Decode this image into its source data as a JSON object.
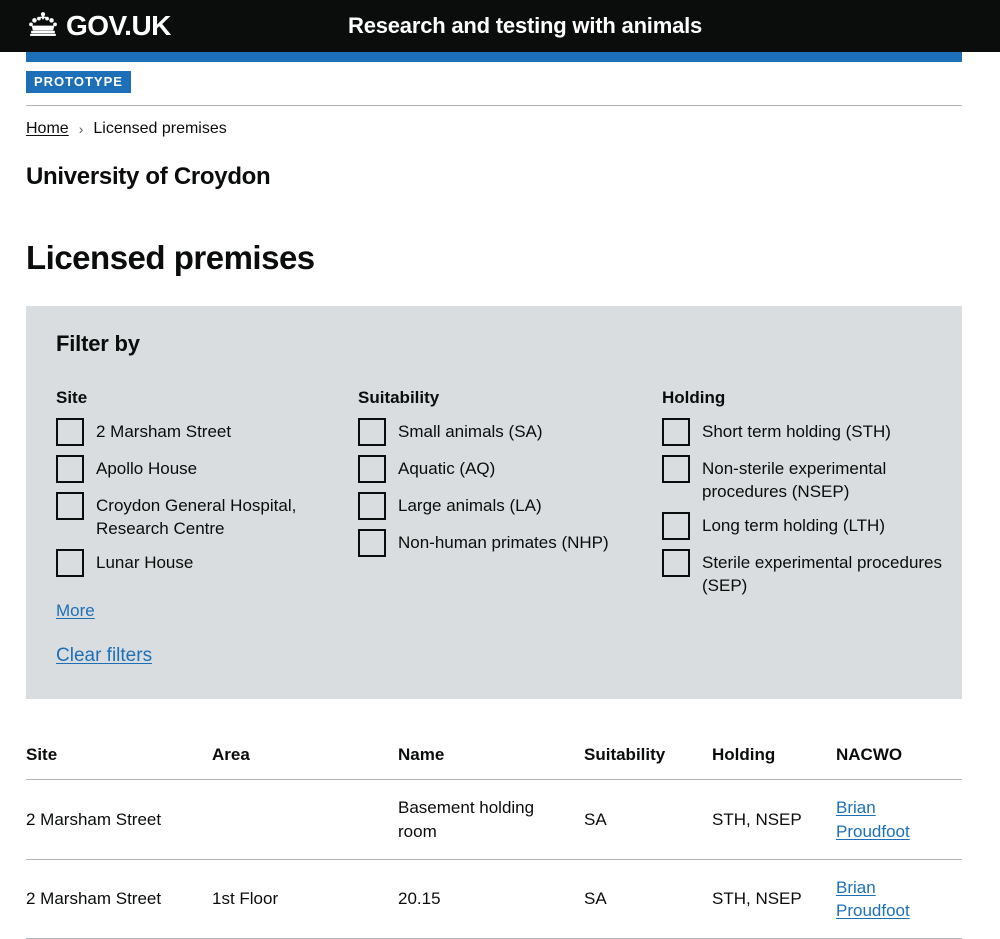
{
  "header": {
    "logo_text": "GOV.UK",
    "crown_icon": "crown-icon",
    "service_name": "Research and testing with animals"
  },
  "phase_banner": {
    "tag": "PROTOTYPE"
  },
  "breadcrumbs": {
    "home": "Home",
    "separator": "›",
    "current": "Licensed premises"
  },
  "page": {
    "caption": "University of Croydon",
    "title": "Licensed premises"
  },
  "filter": {
    "heading": "Filter by",
    "groups": [
      {
        "legend": "Site",
        "options": [
          {
            "label": "2 Marsham Street",
            "checked": false
          },
          {
            "label": "Apollo House",
            "checked": false
          },
          {
            "label": "Croydon General Hospital, Research Centre",
            "checked": false
          },
          {
            "label": "Lunar House",
            "checked": false
          }
        ]
      },
      {
        "legend": "Suitability",
        "options": [
          {
            "label": "Small animals (SA)",
            "checked": false
          },
          {
            "label": "Aquatic (AQ)",
            "checked": false
          },
          {
            "label": "Large animals (LA)",
            "checked": false
          },
          {
            "label": "Non-human primates (NHP)",
            "checked": false
          }
        ]
      },
      {
        "legend": "Holding",
        "options": [
          {
            "label": "Short term holding (STH)",
            "checked": false
          },
          {
            "label": "Non-sterile experimental procedures (NSEP)",
            "checked": false
          },
          {
            "label": "Long term holding (LTH)",
            "checked": false
          },
          {
            "label": "Sterile experimental procedures (SEP)",
            "checked": false
          }
        ]
      }
    ],
    "more_link": "More",
    "clear_link": "Clear filters"
  },
  "table": {
    "columns": [
      "Site",
      "Area",
      "Name",
      "Suitability",
      "Holding",
      "NACWO"
    ],
    "rows": [
      {
        "site": "2 Marsham Street",
        "area": "",
        "name": "Basement holding room",
        "suitability": "SA",
        "holding": "STH, NSEP",
        "nacwo": "Brian Proudfoot"
      },
      {
        "site": "2 Marsham Street",
        "area": "1st Floor",
        "name": "20.15",
        "suitability": "SA",
        "holding": "STH, NSEP",
        "nacwo": "Brian Proudfoot"
      }
    ]
  },
  "colors": {
    "brand_black": "#0b0c0c",
    "govuk_blue": "#1d70b8",
    "panel_grey": "#dadddf",
    "border_grey": "#b1b4b6"
  }
}
